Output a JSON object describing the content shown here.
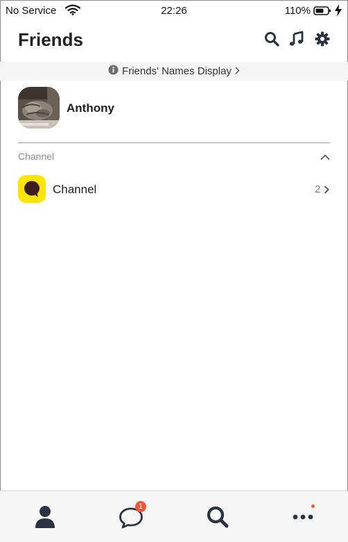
{
  "status_bar": {
    "carrier": "No Service",
    "time": "22:26",
    "battery": "110%"
  },
  "header": {
    "title": "Friends",
    "icons": [
      "search-icon",
      "music-icon",
      "gear-icon"
    ]
  },
  "notice": {
    "text": "Friends' Names Display"
  },
  "profile": {
    "name": "Anthony"
  },
  "channel_section": {
    "label": "Channel",
    "items": [
      {
        "name": "Channel",
        "count": "2"
      }
    ]
  },
  "tabbar": {
    "tabs": [
      {
        "name": "friends",
        "icon": "person-icon"
      },
      {
        "name": "chats",
        "icon": "chat-bubble-icon",
        "badge": "1"
      },
      {
        "name": "search",
        "icon": "search-icon"
      },
      {
        "name": "more",
        "icon": "more-dots-icon"
      }
    ]
  },
  "colors": {
    "channel_yellow": "#fee500",
    "badge_red": "#f5563a",
    "icon_dark": "#2b3340"
  }
}
